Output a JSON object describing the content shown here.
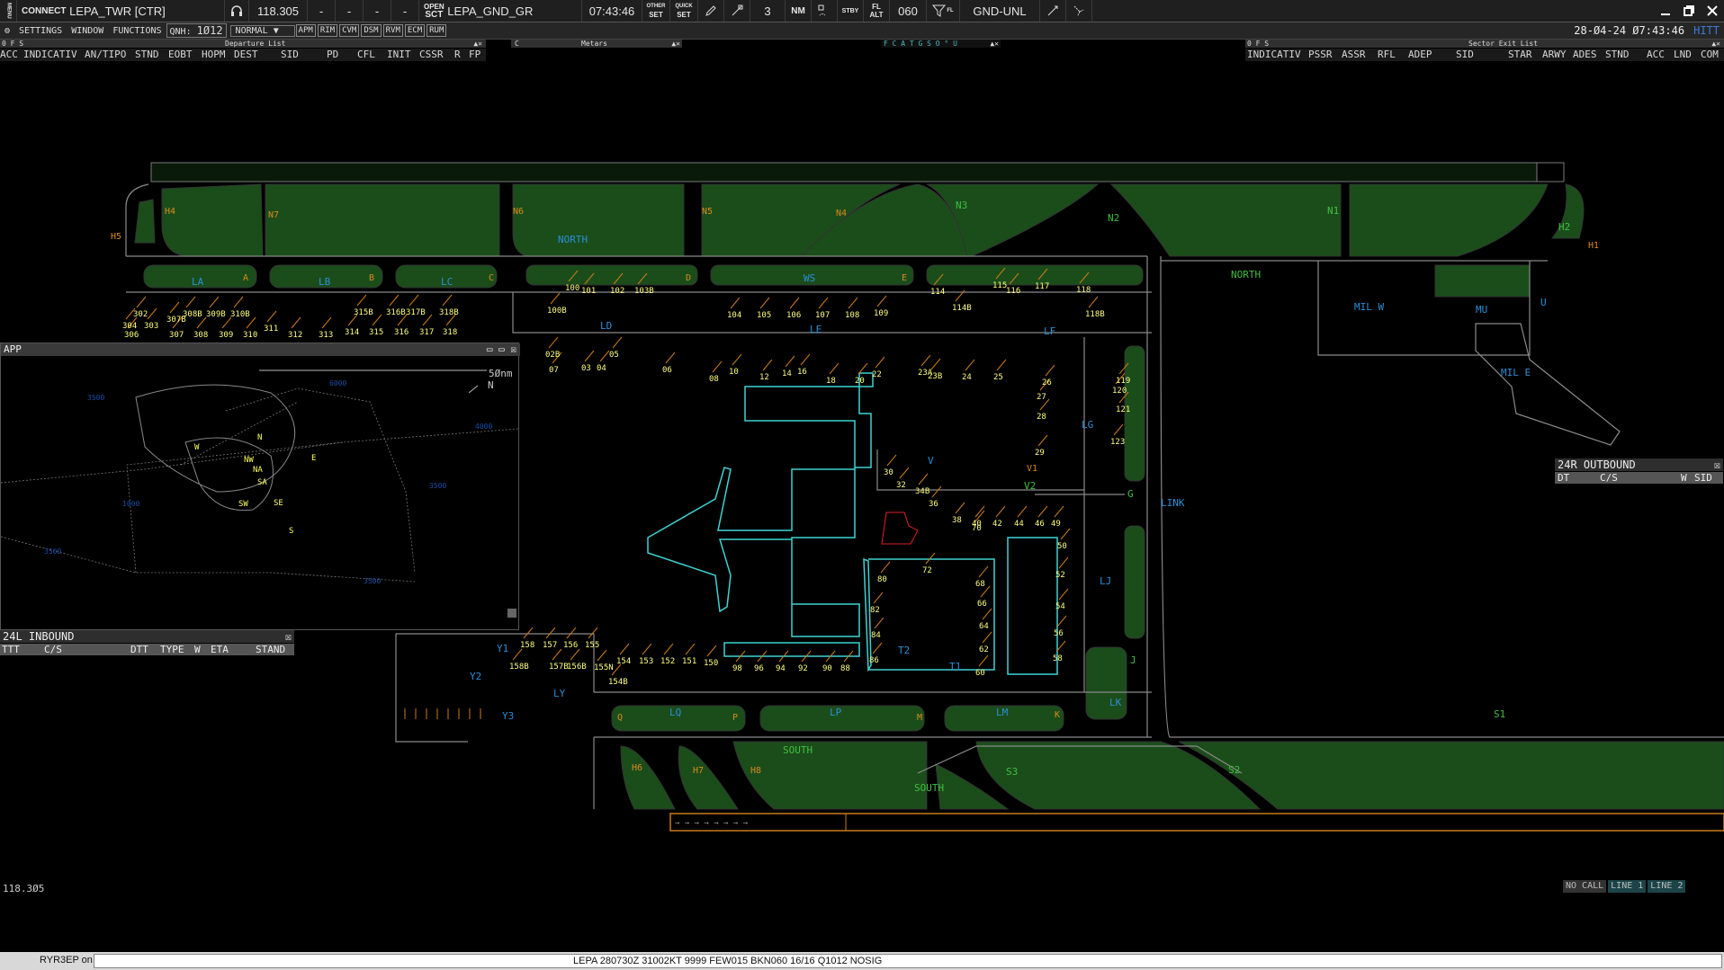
{
  "colors": {
    "apron": "#1b4d1b",
    "taxi": "#9a9a9a",
    "stand": "#ff9f1a",
    "stand_label": "#ffff80",
    "terminal": "#3fd2d2",
    "label_blue": "#2b8fd6",
    "label_green": "#3fbf3f",
    "label_orange": "#d88a1a",
    "outline": "#8a8a8a"
  },
  "topbar": {
    "connect": "CONNECT",
    "position": "LEPA_TWR [CTR]",
    "headset_icon": "headset-icon",
    "frequency": "118.305",
    "dash1": "-",
    "dash2": "-",
    "dash3": "-",
    "dash4": "-",
    "open": "OPEN",
    "sct": "SCT",
    "sector": "LEPA_GND_GR",
    "time": "07:43:46",
    "other": "OTHER",
    "set": "SET",
    "quick": "QUICK",
    "set2": "SET",
    "count": "3",
    "nm": "NM",
    "stby": "STBY",
    "fl": "FL",
    "alt": "ALT",
    "level": "060",
    "fl2": "FL",
    "gnd_unl": "GND-UNL",
    "menu": "MENU"
  },
  "row2": {
    "settings": "SETTINGS",
    "window": "WINDOW",
    "functions": "FUNCTIONS",
    "qnh_label": "QNH:",
    "qnh": "1Ø12",
    "mode": "NORMAL",
    "toggles": [
      "APM",
      "RIM",
      "CVM",
      "DSM",
      "RVM",
      "ECM",
      "RUM"
    ],
    "datetime": "28-Ø4-24 Ø7:43:46",
    "hitt": "HITT"
  },
  "departure_list": {
    "title": "Departure List",
    "ofs": "0 F S",
    "columns": [
      "ACC",
      "INDICATIV",
      "AN/TIPO",
      "STND",
      "EOBT",
      "HOPM",
      "DEST",
      "SID",
      "PD",
      "CFL",
      "INIT",
      "CSSR",
      "R",
      "FP"
    ]
  },
  "metars": {
    "title": "Metars",
    "c": "C"
  },
  "fca": {
    "title": "F C A T G S O ° U"
  },
  "sector_exit_list": {
    "title": "Sector Exit List",
    "ofs": "0 F S",
    "columns": [
      "INDICATIV",
      "PSSR",
      "ASSR",
      "RFL",
      "ADEP",
      "SID",
      "STAR",
      "ARWY",
      "ADES",
      "STND",
      "ACC",
      "LND",
      "COM"
    ]
  },
  "app_window": {
    "title": "APP",
    "scale": "5Ønm",
    "north": "N",
    "alt_labels": [
      "3500",
      "6000",
      "4000",
      "3500",
      "1000",
      "3500",
      "3500",
      "3500"
    ],
    "fixes": [
      "N",
      "W",
      "NW",
      "E",
      "NA",
      "SA",
      "SW",
      "SE",
      "S"
    ]
  },
  "inbound_24l": {
    "title": "24L INBOUND",
    "columns": [
      "TTT",
      "C/S",
      "DTT",
      "TYPE",
      "W",
      "ETA",
      "STAND"
    ]
  },
  "outbound_24r": {
    "title": "24R OUTBOUND",
    "columns": [
      "DT",
      "C/S",
      "W",
      "SID"
    ]
  },
  "map": {
    "areas_blue": [
      "NORTH",
      "LE",
      "LD",
      "LG",
      "LJ",
      "LK",
      "LINK",
      "MIL W",
      "MIL E",
      "MU",
      "U",
      "LM",
      "LP",
      "LQ",
      "LY",
      "Y2",
      "Y1",
      "Y3",
      "V",
      "T1",
      "T2",
      "LA",
      "LB",
      "LC",
      "WS",
      "LF"
    ],
    "areas_green": [
      "NORTH",
      "N3",
      "N2",
      "N1",
      "H2",
      "V2",
      "G",
      "J",
      "SOUTH",
      "S1",
      "S2",
      "S3",
      "SOUTH"
    ],
    "areas_orange": [
      "H5",
      "H4",
      "N7",
      "N6",
      "N5",
      "N4",
      "H1",
      "H6",
      "H7",
      "H8",
      "A",
      "B",
      "C",
      "D",
      "E",
      "Q",
      "P",
      "M",
      "K",
      "V1"
    ],
    "stands": [
      "100",
      "101",
      "102",
      "103B",
      "104",
      "105",
      "106",
      "107",
      "108",
      "109",
      "100B",
      "114",
      "114B",
      "115",
      "116",
      "117",
      "118",
      "118B",
      "119",
      "120",
      "121",
      "123",
      "02B",
      "03",
      "04",
      "05",
      "06",
      "07",
      "08",
      "10",
      "12",
      "14",
      "16",
      "18",
      "20",
      "22",
      "23A",
      "23B",
      "24",
      "25",
      "26",
      "27",
      "28",
      "29",
      "30",
      "32",
      "34B",
      "36",
      "38",
      "40",
      "42",
      "44",
      "46",
      "49",
      "50",
      "52",
      "54",
      "56",
      "58",
      "60",
      "62",
      "64",
      "66",
      "68",
      "70",
      "72",
      "80",
      "82",
      "84",
      "86",
      "88",
      "90",
      "92",
      "94",
      "96",
      "98",
      "150",
      "151",
      "152",
      "153",
      "154",
      "154B",
      "155",
      "155N",
      "156",
      "156B",
      "157",
      "157B",
      "158",
      "158B",
      "302",
      "303",
      "304",
      "306",
      "307",
      "307B",
      "308",
      "308B",
      "309",
      "309B",
      "310",
      "310B",
      "311",
      "312",
      "313",
      "314",
      "315",
      "315B",
      "316",
      "316B",
      "317",
      "317B",
      "318",
      "318B"
    ]
  },
  "bottom": {
    "freq": "118.3Ø5",
    "no_call": "NO CALL",
    "line1": "LINE 1",
    "line2": "LINE 2",
    "callsign": "RYR3EP on",
    "metar": "LEPA 280730Z 31002KT 9999 FEW015 BKN060 16/16 Q1012 NOSIG"
  }
}
